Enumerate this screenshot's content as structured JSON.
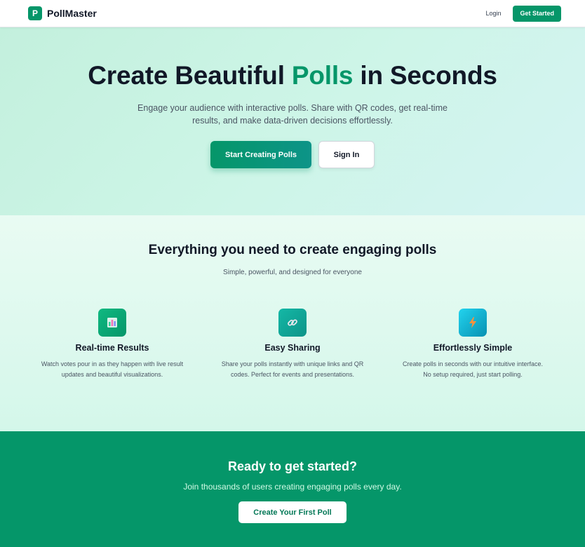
{
  "nav": {
    "logo_letter": "P",
    "brand": "PollMaster",
    "login_label": "Login",
    "get_started_label": "Get Started"
  },
  "hero": {
    "title_prefix": "Create Beautiful ",
    "title_accent": "Polls",
    "title_suffix": " in Seconds",
    "subtitle": "Engage your audience with interactive polls. Share with QR codes, get real-time results, and make data-driven decisions effortlessly.",
    "primary_label": "Start Creating Polls",
    "secondary_label": "Sign In"
  },
  "features": {
    "title": "Everything you need to create engaging polls",
    "subtitle": "Simple, powerful, and designed for everyone",
    "items": [
      {
        "icon": "bar-chart-icon",
        "title": "Real-time Results",
        "description": "Watch votes pour in as they happen with live result updates and beautiful visualizations."
      },
      {
        "icon": "link-icon",
        "title": "Easy Sharing",
        "description": "Share your polls instantly with unique links and QR codes. Perfect for events and presentations."
      },
      {
        "icon": "lightning-icon",
        "title": "Effortlessly Simple",
        "description": "Create polls in seconds with our intuitive interface. No setup required, just start polling."
      }
    ]
  },
  "cta": {
    "title": "Ready to get started?",
    "subtitle": "Join thousands of users creating engaging polls every day.",
    "button_label": "Create Your First Poll"
  },
  "colors": {
    "brand": "#059669",
    "text": "#111827",
    "muted": "#4b5563"
  }
}
